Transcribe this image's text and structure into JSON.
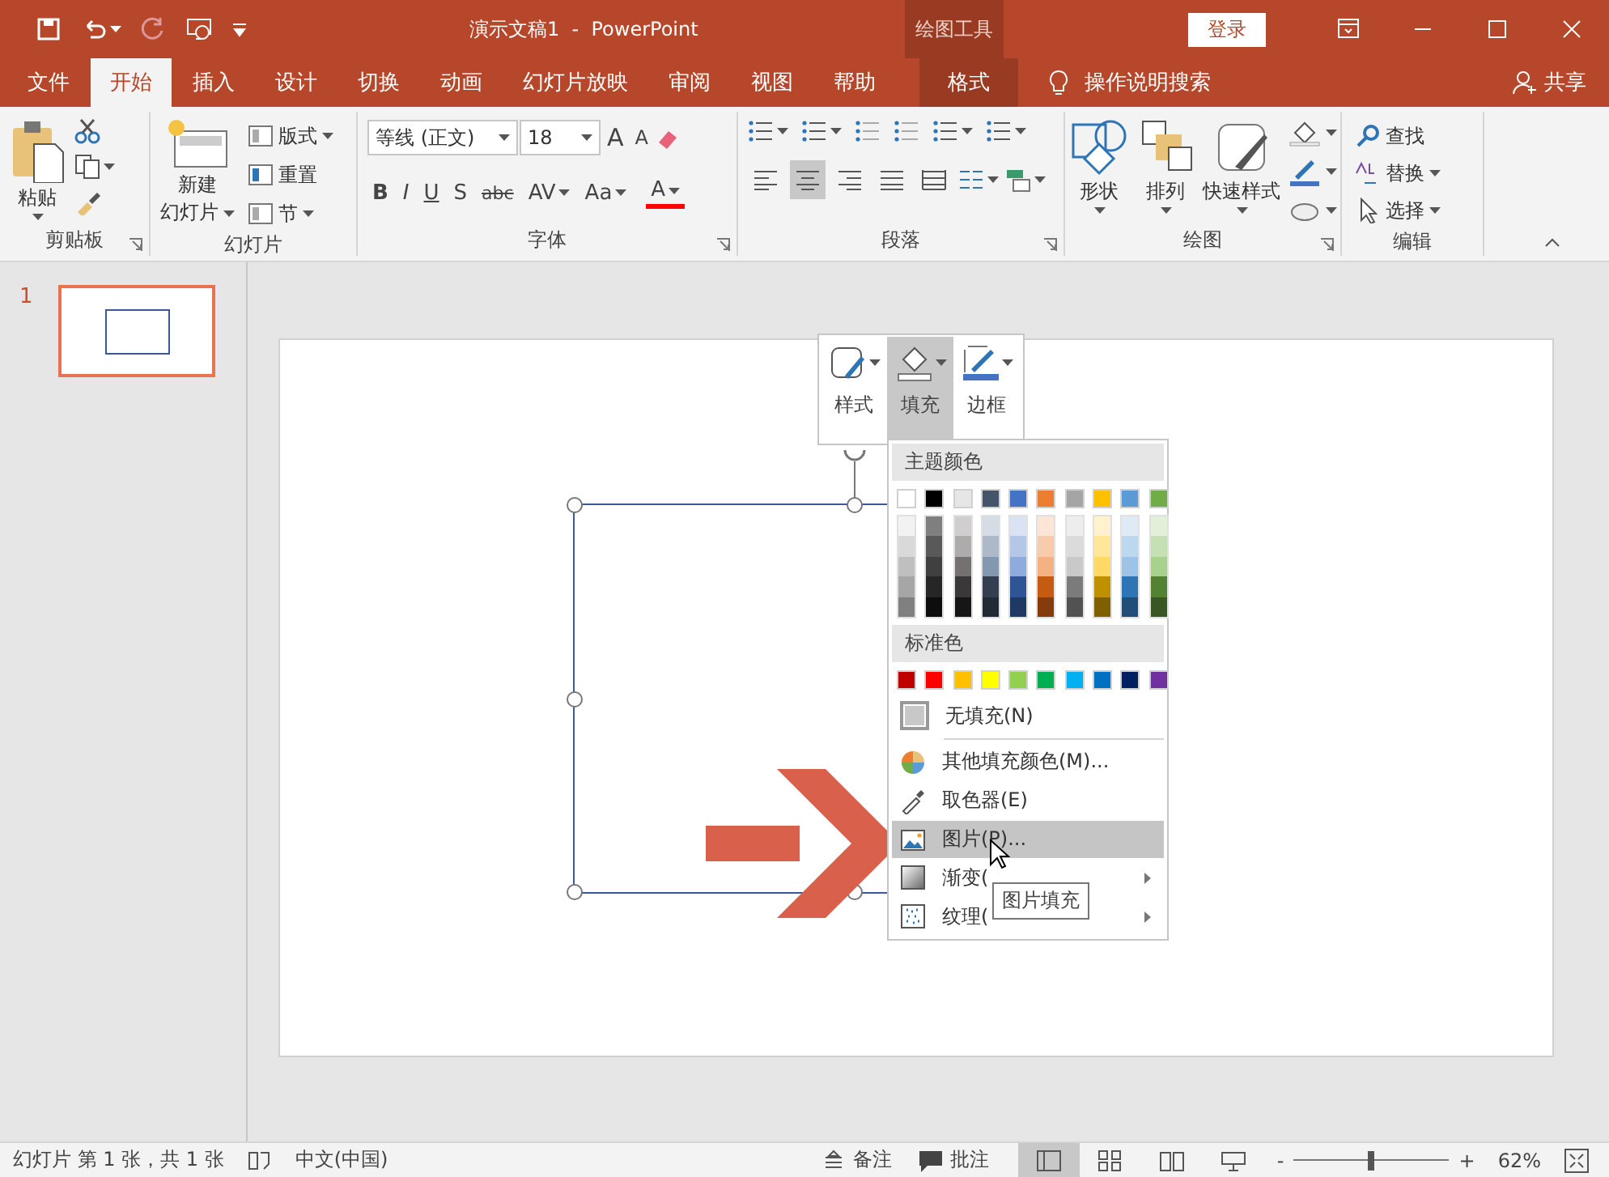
{
  "window": {
    "title": "演示文稿1  -  PowerPoint",
    "context_group": "绘图工具",
    "sign_in": "登录"
  },
  "tabs": [
    {
      "label": "文件",
      "kind": "normal",
      "selected": false
    },
    {
      "label": "开始",
      "kind": "normal",
      "selected": true
    },
    {
      "label": "插入",
      "kind": "normal",
      "selected": false
    },
    {
      "label": "设计",
      "kind": "normal",
      "selected": false
    },
    {
      "label": "切换",
      "kind": "normal",
      "selected": false
    },
    {
      "label": "动画",
      "kind": "normal",
      "selected": false
    },
    {
      "label": "幻灯片放映",
      "kind": "normal",
      "selected": false
    },
    {
      "label": "审阅",
      "kind": "normal",
      "selected": false
    },
    {
      "label": "视图",
      "kind": "normal",
      "selected": false
    },
    {
      "label": "帮助",
      "kind": "normal",
      "selected": false
    },
    {
      "label": "格式",
      "kind": "context",
      "selected": false
    }
  ],
  "tell_me": "操作说明搜索",
  "share": "共享",
  "ribbon": {
    "groups": [
      {
        "kind": "clipboard",
        "label": "剪贴板",
        "launcher": true,
        "paste": "粘贴"
      },
      {
        "kind": "slides",
        "label": "幻灯片",
        "launcher": false,
        "new_slide": [
          "新建",
          "幻灯片"
        ],
        "commands": [
          "版式",
          "重置",
          "节"
        ]
      },
      {
        "kind": "font",
        "label": "字体",
        "launcher": true,
        "font_name": "等线 (正文)",
        "font_size": "18",
        "size_buttons": [
          "A",
          "A"
        ],
        "format_buttons": [
          "B",
          "I",
          "U",
          "S",
          "abc",
          "AV",
          "Aa"
        ],
        "color_button": "A"
      },
      {
        "kind": "paragraph",
        "label": "段落",
        "launcher": true,
        "alignments": [
          {
            "kind": "left",
            "selected": false
          },
          {
            "kind": "center",
            "selected": true
          },
          {
            "kind": "right",
            "selected": false
          },
          {
            "kind": "justify",
            "selected": false
          },
          {
            "kind": "distributed",
            "selected": false
          }
        ]
      },
      {
        "kind": "drawing",
        "label": "绘图",
        "launcher": true,
        "buttons": [
          "形状",
          "排列",
          "快速样式"
        ]
      },
      {
        "kind": "editing",
        "label": "编辑",
        "launcher": false,
        "commands": [
          "查找",
          "替换",
          "选择"
        ]
      }
    ]
  },
  "slide_panel": {
    "slides": [
      {
        "number": "1",
        "selected": true
      }
    ]
  },
  "mini_toolbar": {
    "buttons": [
      {
        "label": "样式",
        "kind": "style",
        "selected": false
      },
      {
        "label": "填充",
        "kind": "fill",
        "selected": true
      },
      {
        "label": "边框",
        "kind": "outline",
        "selected": false
      }
    ]
  },
  "fill_menu": {
    "theme_heading": "主题颜色",
    "theme_colors": [
      {
        "color": "#ffffff",
        "shades": [
          {
            "color": "#f2f2f2"
          },
          {
            "color": "#d9d9d9"
          },
          {
            "color": "#bfbfbf"
          },
          {
            "color": "#a6a6a6"
          },
          {
            "color": "#808080"
          }
        ]
      },
      {
        "color": "#000000",
        "shades": [
          {
            "color": "#7f7f7f"
          },
          {
            "color": "#595959"
          },
          {
            "color": "#404040"
          },
          {
            "color": "#262626"
          },
          {
            "color": "#0d0d0d"
          }
        ]
      },
      {
        "color": "#e7e6e6",
        "shades": [
          {
            "color": "#d0cece"
          },
          {
            "color": "#aeabab"
          },
          {
            "color": "#757171"
          },
          {
            "color": "#3a3838"
          },
          {
            "color": "#171616"
          }
        ]
      },
      {
        "color": "#44546a",
        "shades": [
          {
            "color": "#d6dce5"
          },
          {
            "color": "#adb9ca"
          },
          {
            "color": "#8497b0"
          },
          {
            "color": "#333f50"
          },
          {
            "color": "#222a35"
          }
        ]
      },
      {
        "color": "#4472c4",
        "shades": [
          {
            "color": "#dae3f3"
          },
          {
            "color": "#b4c7e7"
          },
          {
            "color": "#8faadc"
          },
          {
            "color": "#2f5597"
          },
          {
            "color": "#203864"
          }
        ]
      },
      {
        "color": "#ed7d31",
        "shades": [
          {
            "color": "#fbe5d6"
          },
          {
            "color": "#f8cbad"
          },
          {
            "color": "#f4b183"
          },
          {
            "color": "#c55a11"
          },
          {
            "color": "#843c0c"
          }
        ]
      },
      {
        "color": "#a5a5a5",
        "shades": [
          {
            "color": "#ededed"
          },
          {
            "color": "#dbdbdb"
          },
          {
            "color": "#c9c9c9"
          },
          {
            "color": "#7b7b7b"
          },
          {
            "color": "#525252"
          }
        ]
      },
      {
        "color": "#ffc000",
        "shades": [
          {
            "color": "#fff2cc"
          },
          {
            "color": "#ffe699"
          },
          {
            "color": "#ffd966"
          },
          {
            "color": "#bf9000"
          },
          {
            "color": "#7f6000"
          }
        ]
      },
      {
        "color": "#5b9bd5",
        "shades": [
          {
            "color": "#deebf7"
          },
          {
            "color": "#bdd7ee"
          },
          {
            "color": "#9dc3e6"
          },
          {
            "color": "#2e75b6"
          },
          {
            "color": "#1f4e79"
          }
        ]
      },
      {
        "color": "#70ad47",
        "shades": [
          {
            "color": "#e2f0d9"
          },
          {
            "color": "#c5e0b4"
          },
          {
            "color": "#a9d18e"
          },
          {
            "color": "#548235"
          },
          {
            "color": "#385723"
          }
        ]
      }
    ],
    "standard_heading": "标准色",
    "standard_colors": [
      {
        "color": "#c00000"
      },
      {
        "color": "#ff0000"
      },
      {
        "color": "#ffc000"
      },
      {
        "color": "#ffff00"
      },
      {
        "color": "#92d050"
      },
      {
        "color": "#00b050"
      },
      {
        "color": "#00b0f0"
      },
      {
        "color": "#0070c0"
      },
      {
        "color": "#002060"
      },
      {
        "color": "#7030a0"
      }
    ],
    "no_fill": "无填充(N)",
    "items": [
      {
        "label": "其他填充颜色(M)...",
        "kind": "palette",
        "selected": false,
        "submenu": false
      },
      {
        "label": "取色器(E)",
        "kind": "eyedropper",
        "selected": false,
        "submenu": false
      },
      {
        "label": "图片(P)...",
        "kind": "picture",
        "selected": true,
        "submenu": false
      },
      {
        "label": "渐变(",
        "kind": "gradient",
        "selected": false,
        "submenu": true
      },
      {
        "label": "纹理(",
        "kind": "texture",
        "selected": false,
        "submenu": true
      }
    ]
  },
  "tooltip": "图片填充",
  "status_bar": {
    "slide_info": "幻灯片 第 1 张，共 1 张",
    "language": "中文(中国)",
    "notes": "备注",
    "comments": "批注",
    "views": [
      {
        "kind": "normal",
        "selected": true
      },
      {
        "kind": "sorter",
        "selected": false
      },
      {
        "kind": "reading",
        "selected": false
      },
      {
        "kind": "slideshow",
        "selected": false
      }
    ],
    "zoom_out": "-",
    "zoom_in": "+",
    "zoom": {
      "level": 0.5
    },
    "zoom_percent": "62%"
  }
}
